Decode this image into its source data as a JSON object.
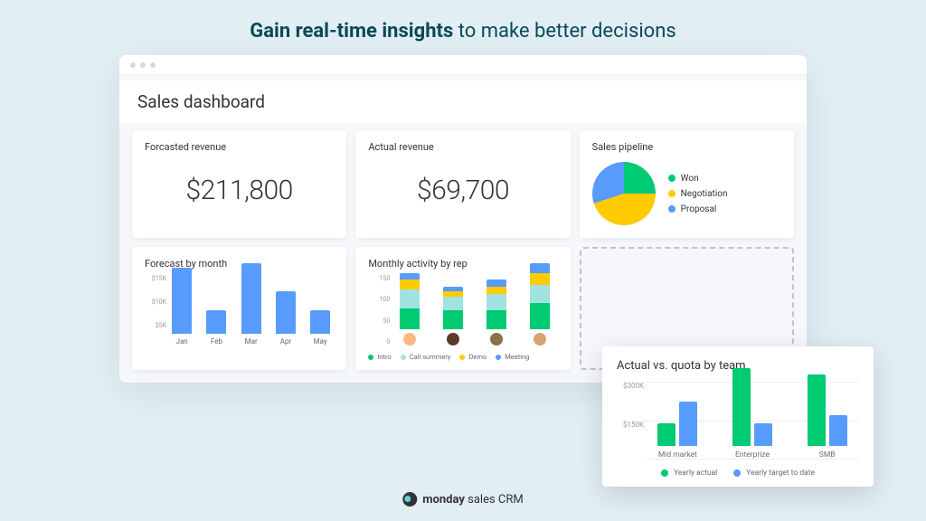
{
  "headline": {
    "bold": "Gain real-time insights",
    "rest": " to make better decisions"
  },
  "app": {
    "title": "Sales dashboard"
  },
  "cards": {
    "forecasted": {
      "title": "Forcasted revenue",
      "value": "$211,800"
    },
    "actual": {
      "title": "Actual revenue",
      "value": "$69,700"
    },
    "pipeline": {
      "title": "Sales pipeline"
    },
    "forecast_by_month": {
      "title": "Forecast by month"
    },
    "monthly_activity": {
      "title": "Monthly activity by rep"
    },
    "actual_vs_quota": {
      "title": "Actual vs. quota by team"
    }
  },
  "pipeline_legend": [
    {
      "label": "Won",
      "color": "#00ca72"
    },
    {
      "label": "Negotiation",
      "color": "#ffcb00"
    },
    {
      "label": "Proposal",
      "color": "#579bfc"
    }
  ],
  "forecast_yaxis": [
    "$15K",
    "$10K",
    "$5K",
    ""
  ],
  "activity_yaxis": [
    "150",
    "100",
    "50",
    "0"
  ],
  "activity_legend": [
    {
      "label": "Intro",
      "color": "#00ca72"
    },
    {
      "label": "Call summery",
      "color": "#a1e3e3"
    },
    {
      "label": "Demo",
      "color": "#ffcb00"
    },
    {
      "label": "Meeting",
      "color": "#579bfc"
    }
  ],
  "quota_yaxis": [
    "$300K",
    "$150K",
    ""
  ],
  "quota_legend": [
    {
      "label": "Yearly actual",
      "color": "#00ca72"
    },
    {
      "label": "Yearly target to date",
      "color": "#579bfc"
    }
  ],
  "brand": {
    "bold": "monday",
    "rest": " sales CRM"
  },
  "chart_data": [
    {
      "type": "pie",
      "title": "Sales pipeline",
      "series": [
        {
          "name": "Won",
          "value": 25,
          "color": "#00ca72"
        },
        {
          "name": "Negotiation",
          "value": 45,
          "color": "#ffcb00"
        },
        {
          "name": "Proposal",
          "value": 30,
          "color": "#579bfc"
        }
      ]
    },
    {
      "type": "bar",
      "title": "Forecast by month",
      "categories": [
        "Jan",
        "Feb",
        "Mar",
        "Apr",
        "May"
      ],
      "values": [
        14000,
        5000,
        15000,
        9000,
        5000
      ],
      "ylabel": "$",
      "ylim": [
        0,
        15000
      ],
      "color": "#579bfc"
    },
    {
      "type": "bar",
      "title": "Monthly activity by rep",
      "stacked": true,
      "categories": [
        "Rep 1",
        "Rep 2",
        "Rep 3",
        "Rep 4"
      ],
      "series": [
        {
          "name": "Intro",
          "color": "#00ca72",
          "values": [
            45,
            40,
            40,
            55
          ]
        },
        {
          "name": "Call summery",
          "color": "#a1e3e3",
          "values": [
            40,
            30,
            35,
            40
          ]
        },
        {
          "name": "Demo",
          "color": "#ffcb00",
          "values": [
            20,
            10,
            15,
            25
          ]
        },
        {
          "name": "Meeting",
          "color": "#579bfc",
          "values": [
            15,
            10,
            15,
            20
          ]
        }
      ],
      "ylim": [
        0,
        150
      ]
    },
    {
      "type": "bar",
      "title": "Actual vs. quota by team",
      "grouped": true,
      "categories": [
        "Mid market",
        "Enterprize",
        "SMB"
      ],
      "series": [
        {
          "name": "Yearly actual",
          "color": "#00ca72",
          "values": [
            100000,
            350000,
            320000
          ]
        },
        {
          "name": "Yearly target to date",
          "color": "#579bfc",
          "values": [
            200000,
            100000,
            140000
          ]
        }
      ],
      "ylim": [
        0,
        350000
      ]
    }
  ]
}
